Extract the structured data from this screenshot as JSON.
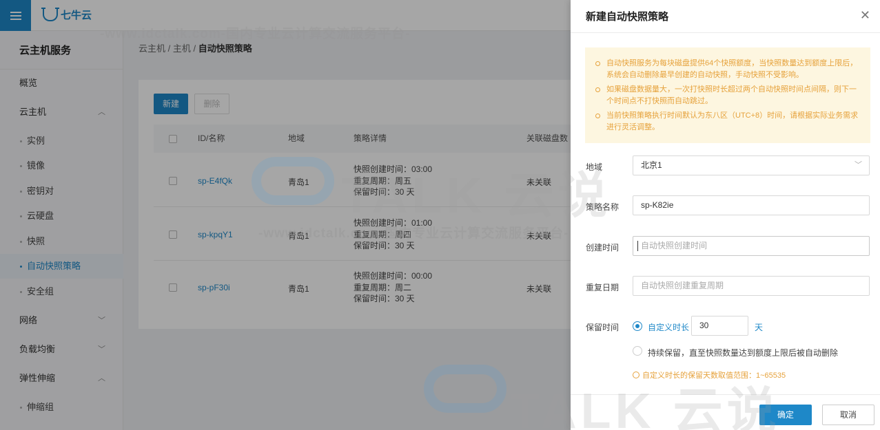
{
  "topbar": {
    "logo_text": "七牛云",
    "menu_icon": "hamburger-menu-icon"
  },
  "sidebar": {
    "title": "云主机服务",
    "items": [
      {
        "label": "概览"
      },
      {
        "label": "云主机",
        "chevron": "︿"
      },
      {
        "label": "网络",
        "chevron": "﹀"
      },
      {
        "label": "负载均衡",
        "chevron": "﹀"
      },
      {
        "label": "弹性伸缩",
        "chevron": "︿"
      }
    ],
    "host_subitems": [
      "实例",
      "镜像",
      "密钥对",
      "云硬盘",
      "快照",
      "自动快照策略",
      "安全组"
    ],
    "scaling_subitems": [
      "伸缩组"
    ]
  },
  "breadcrumb": {
    "part1": "云主机",
    "sep": " / ",
    "part2": "主机",
    "current": "自动快照策略"
  },
  "toolbar": {
    "new_label": "新建",
    "delete_label": "删除"
  },
  "table": {
    "headers": [
      "ID/名称",
      "地域",
      "策略详情",
      "关联磁盘数"
    ],
    "rows": [
      {
        "id": "sp-E4fQk",
        "region": "青岛1",
        "detail1": "快照创建时间：03:00",
        "detail2": "重复周期：周五",
        "detail3": "保留时间：30 天",
        "disks": "未关联"
      },
      {
        "id": "sp-kpqY1",
        "region": "青岛1",
        "detail1": "快照创建时间：01:00",
        "detail2": "重复周期：周四",
        "detail3": "保留时间：30 天",
        "disks": "未关联"
      },
      {
        "id": "sp-pF30i",
        "region": "青岛1",
        "detail1": "快照创建时间：00:00",
        "detail2": "重复周期：周二",
        "detail3": "保留时间：30 天",
        "disks": "未关联"
      }
    ]
  },
  "drawer": {
    "title": "新建自动快照策略",
    "close_icon": "close-icon",
    "notices": [
      "自动快照服务为每块磁盘提供64个快照额度，当快照数量达到额度上限后，系统会自动删除最早创建的自动快照，手动快照不受影响。",
      "如果磁盘数据量大，一次打快照时长超过两个自动快照时间点间隔，则下一个时间点不打快照而自动跳过。",
      "当前快照策略执行时间默认为东八区（UTC+8）时间，请根据实际业务需求进行灵活调整。"
    ],
    "form": {
      "region_label": "地域",
      "region_value": "北京1",
      "name_label": "策略名称",
      "name_value": "sp-K82ie",
      "time_label": "创建时间",
      "time_placeholder": "自动快照创建时间",
      "repeat_label": "重复日期",
      "repeat_placeholder": "自动快照创建重复周期",
      "retain_label": "保留时间",
      "custom_label": "自定义时长",
      "custom_value": "30",
      "custom_unit": "天",
      "persist_label": "持续保留，直至快照数量达到额度上限后被自动删除",
      "hint": "自定义时长的保留天数取值范围：1~65535"
    },
    "confirm_label": "确定",
    "cancel_label": "取消"
  },
  "watermark": {
    "brand": "TALK 云说",
    "url": "-www.idctalk.com-国内专业云计算交流服务平台-"
  },
  "colors": {
    "accent": "#1e88c8",
    "notice_bg": "#fdf6e0",
    "notice_text": "#e6a23c"
  }
}
